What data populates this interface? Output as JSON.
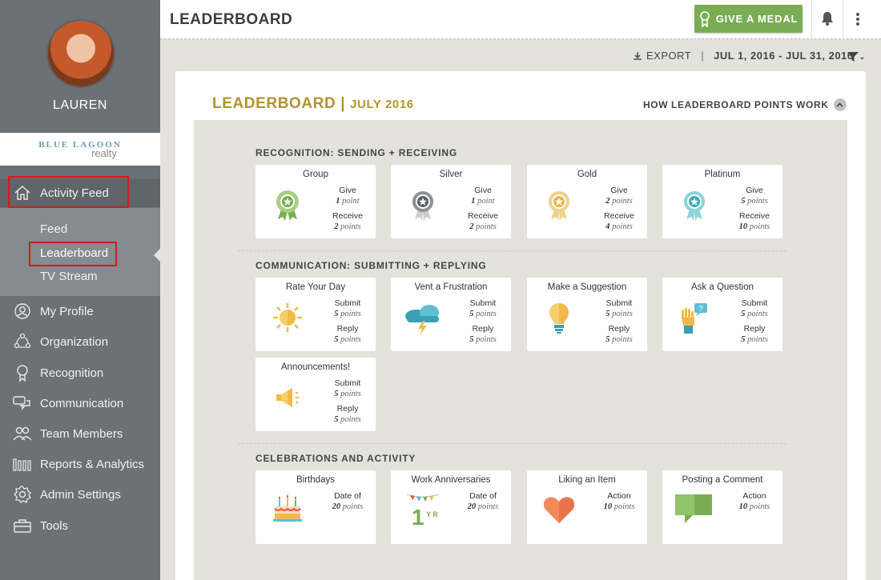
{
  "sidebar": {
    "username": "LAUREN",
    "brand": {
      "name": "BLUE LAGOON",
      "sub": "realty"
    },
    "nav": [
      {
        "label": "Activity Feed",
        "icon": "home-icon"
      },
      {
        "label": "My Profile",
        "icon": "user-icon"
      },
      {
        "label": "Organization",
        "icon": "organization-icon"
      },
      {
        "label": "Recognition",
        "icon": "ribbon-icon"
      },
      {
        "label": "Communication",
        "icon": "chat-icon"
      },
      {
        "label": "Team Members",
        "icon": "team-icon"
      },
      {
        "label": "Reports & Analytics",
        "icon": "bar-chart-icon"
      },
      {
        "label": "Admin Settings",
        "icon": "gear-icon"
      },
      {
        "label": "Tools",
        "icon": "toolbox-icon"
      }
    ],
    "subnav": [
      {
        "label": "Feed"
      },
      {
        "label": "Leaderboard"
      },
      {
        "label": "TV Stream"
      }
    ]
  },
  "header": {
    "title": "LEADERBOARD",
    "medal_button": "GIVE A MEDAL"
  },
  "toolbar": {
    "export_label": "EXPORT",
    "divider": "|",
    "date_range": "JUL 1, 2016 - JUL 31, 2016"
  },
  "panel": {
    "title": "LEADERBOARD |",
    "month": "JULY 2016",
    "how_link": "HOW LEADERBOARD POINTS WORK"
  },
  "sections": [
    {
      "title": "RECOGNITION: SENDING + RECEIVING",
      "tiles": [
        {
          "name": "Group",
          "icon": "group-medal-icon",
          "color": "#7aad53",
          "k1": "Give",
          "n1": "1",
          "u1": "point",
          "k2": "Receive",
          "n2": "2",
          "u2": "points"
        },
        {
          "name": "Silver",
          "icon": "silver-medal-icon",
          "color": "#8e9194",
          "k1": "Give",
          "n1": "1",
          "u1": "point",
          "k2": "Receive",
          "n2": "2",
          "u2": "points"
        },
        {
          "name": "Gold",
          "icon": "gold-medal-icon",
          "color": "#e6b84a",
          "k1": "Give",
          "n1": "2",
          "u1": "points",
          "k2": "Receive",
          "n2": "4",
          "u2": "points"
        },
        {
          "name": "Platinum",
          "icon": "platinum-medal-icon",
          "color": "#3aaeb8",
          "k1": "Give",
          "n1": "5",
          "u1": "points",
          "k2": "Receive",
          "n2": "10",
          "u2": "points"
        }
      ]
    },
    {
      "title": "COMMUNICATION: SUBMITTING + REPLYING",
      "tiles": [
        {
          "name": "Rate Your Day",
          "icon": "sun-icon",
          "k1": "Submit",
          "n1": "5",
          "u1": "points",
          "k2": "Reply",
          "n2": "5",
          "u2": "points"
        },
        {
          "name": "Vent a Frustration",
          "icon": "storm-cloud-icon",
          "k1": "Submit",
          "n1": "5",
          "u1": "points",
          "k2": "Reply",
          "n2": "5",
          "u2": "points"
        },
        {
          "name": "Make a Suggestion",
          "icon": "lightbulb-icon",
          "k1": "Submit",
          "n1": "5",
          "u1": "points",
          "k2": "Reply",
          "n2": "5",
          "u2": "points"
        },
        {
          "name": "Ask a Question",
          "icon": "raised-hand-icon",
          "k1": "Submit",
          "n1": "5",
          "u1": "points",
          "k2": "Reply",
          "n2": "5",
          "u2": "points"
        },
        {
          "name": "Announcements!",
          "icon": "megaphone-icon",
          "k1": "Submit",
          "n1": "5",
          "u1": "points",
          "k2": "Reply",
          "n2": "5",
          "u2": "points"
        }
      ]
    },
    {
      "title": "CELEBRATIONS AND ACTIVITY",
      "tiles": [
        {
          "name": "Birthdays",
          "icon": "cake-icon",
          "k1": "Date of",
          "n1": "20",
          "u1": "points"
        },
        {
          "name": "Work Anniversaries",
          "icon": "anniversary-icon",
          "k1": "Date of",
          "n1": "20",
          "u1": "points",
          "anniv_num": "1",
          "anniv_yr": "Y R"
        },
        {
          "name": "Liking an Item",
          "icon": "heart-icon",
          "k1": "Action",
          "n1": "10",
          "u1": "points"
        },
        {
          "name": "Posting a Comment",
          "icon": "comment-icon",
          "k1": "Action",
          "n1": "10",
          "u1": "points"
        }
      ]
    }
  ]
}
